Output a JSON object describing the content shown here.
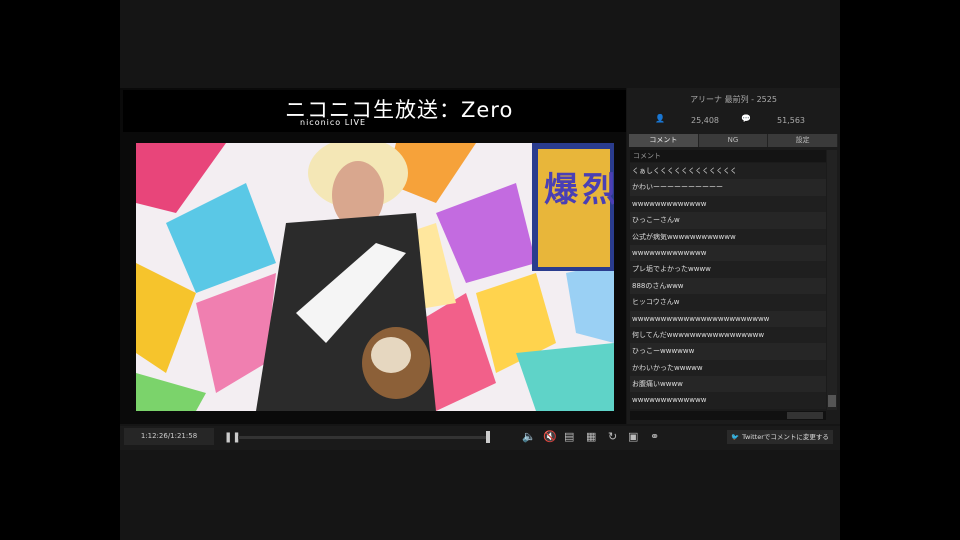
{
  "header": {
    "logo_main": "ニコニコ生放送：Zero",
    "logo_sub": "niconico LIVE"
  },
  "room": {
    "title": "アリーナ 最前列 - 2525",
    "viewers": "25,408",
    "comments_count": "51,563"
  },
  "tabs": [
    {
      "label": "コメント"
    },
    {
      "label": "NG"
    },
    {
      "label": "設定"
    }
  ],
  "comment_list": {
    "header": "コメント",
    "items": [
      "くぁしくくくくくくくくくくくく",
      "かわいーーーーーーーーーー",
      "wwwwwwwwwwwww",
      "ひっこーさんw",
      "公式が病気wwwwwwwwwwww",
      "wwwwwwwwwwwww",
      "プレ垢でよかったwwww",
      "888のさんwww",
      "ヒッコウさんw",
      "wwwwwwwwwwwwwwwwwwwwwwww",
      "何してんだwwwwwwwwwwwwwwwww",
      "ひっこーwwwwww",
      "かわいかったwwwww",
      "お腹痛いwwww",
      "wwwwwwwwwwwww"
    ]
  },
  "controls": {
    "time": "1:12:26/1:21:58",
    "pause_icon": "pause-icon",
    "twitter_label": "Twitterでコメントに変更する"
  },
  "colors": {
    "background": "#000000",
    "panel": "#1b1b1b",
    "twitter_blue": "#6fb6ff"
  }
}
